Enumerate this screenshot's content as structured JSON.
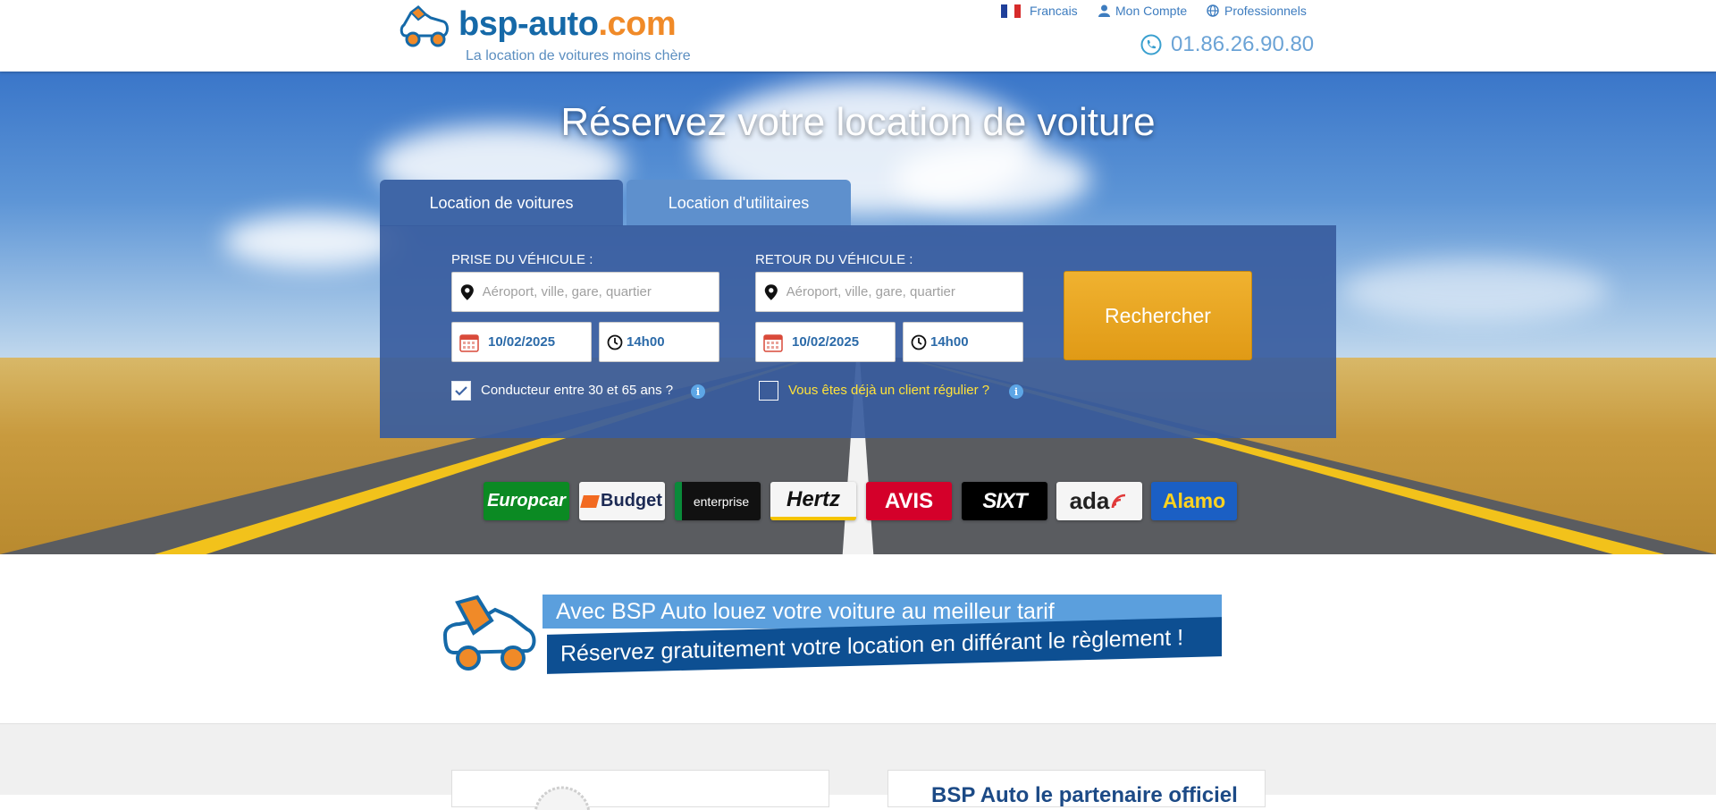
{
  "header": {
    "logo_name": "bsp-auto",
    "logo_tld": ".com",
    "tagline": "La location de voitures moins chère",
    "nav": {
      "language": "Francais",
      "account": "Mon Compte",
      "pro": "Professionnels"
    },
    "phone": "01.86.26.90.80"
  },
  "hero": {
    "title": "Réservez votre location de voiture",
    "tabs": [
      {
        "label": "Location de voitures",
        "active": true
      },
      {
        "label": "Location d'utilitaires",
        "active": false
      }
    ]
  },
  "form": {
    "pickup": {
      "label": "PRISE DU VÉHICULE :",
      "placeholder": "Aéroport, ville, gare, quartier",
      "date": "10/02/2025",
      "time": "14h00"
    },
    "return": {
      "label": "RETOUR DU VÉHICULE :",
      "placeholder": "Aéroport, ville, gare, quartier",
      "date": "10/02/2025",
      "time": "14h00"
    },
    "driver_age": {
      "label": "Conducteur entre 30 et 65 ans ?",
      "checked": true
    },
    "regular_client": {
      "label": "Vous êtes déjà un client régulier ?",
      "checked": false
    },
    "search_button": "Rechercher"
  },
  "brands": [
    {
      "name": "Europcar",
      "bg": "#0b8a23",
      "fg": "#ffffff"
    },
    {
      "name": "Budget",
      "bg": "#f5f5f5",
      "fg": "#1c2a54"
    },
    {
      "name": "enterprise",
      "bg": "#111111",
      "fg": "#ffffff"
    },
    {
      "name": "Hertz",
      "bg": "#f5f5f5",
      "fg": "#111111"
    },
    {
      "name": "AVIS",
      "bg": "#d4002a",
      "fg": "#ffffff"
    },
    {
      "name": "SIXT",
      "bg": "#000000",
      "fg": "#ffffff"
    },
    {
      "name": "ada",
      "bg": "#f5f5f5",
      "fg": "#222222"
    },
    {
      "name": "Alamo",
      "bg": "#1b5fc4",
      "fg": "#ffd21f"
    }
  ],
  "promo": {
    "line1": "Avec BSP Auto louez votre voiture au meilleur tarif",
    "line2": "Réservez gratuitement votre location en différant le règlement !"
  },
  "bottom": {
    "partner_title": "BSP Auto le partenaire officiel"
  },
  "colors": {
    "brand_blue": "#1569a8",
    "brand_orange": "#f08a28",
    "panel": "#385c9e",
    "search_button": "#e9a31f",
    "regular_client_text": "#ffe23a"
  }
}
